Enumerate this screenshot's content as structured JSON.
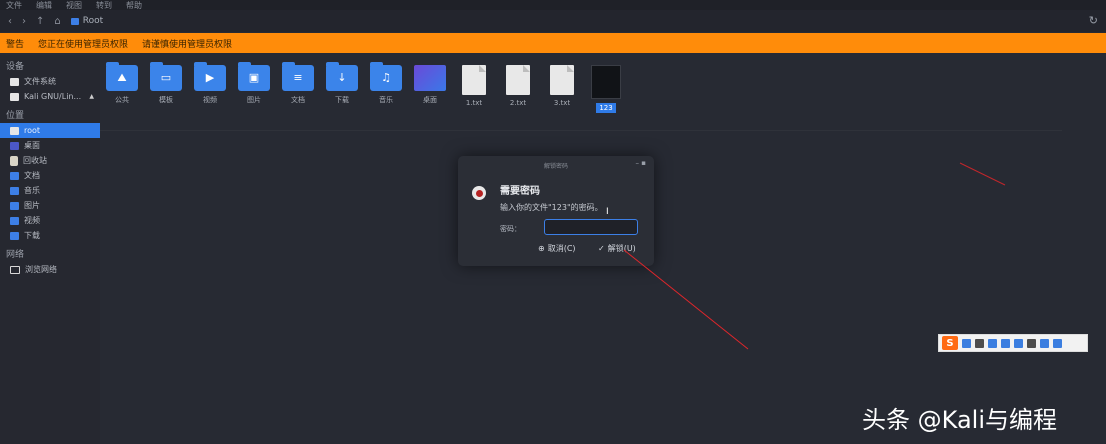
{
  "menubar": {
    "items": [
      "文件",
      "编辑",
      "视图",
      "转到",
      "帮助"
    ]
  },
  "toolbar": {
    "path": "Root",
    "back": "‹",
    "forward": "›",
    "up": "↑",
    "home": "⌂",
    "refresh": "↻"
  },
  "notice": {
    "label": "警告",
    "text1": "您正在使用管理员权限",
    "text2": "请谨慎使用管理员权限"
  },
  "sidebar": {
    "heading_devices": "设备",
    "heading_places": "位置",
    "heading_network": "网络",
    "devices": [
      {
        "label": "文件系统"
      },
      {
        "label": "Kali GNU/Lin..."
      }
    ],
    "places": [
      {
        "label": "root"
      },
      {
        "label": "桌面"
      },
      {
        "label": "回收站"
      },
      {
        "label": "文档"
      },
      {
        "label": "音乐"
      },
      {
        "label": "图片"
      },
      {
        "label": "视频"
      },
      {
        "label": "下载"
      }
    ],
    "network": [
      {
        "label": "浏览网络"
      }
    ]
  },
  "files": [
    {
      "label": "公共",
      "glyph": "⛰"
    },
    {
      "label": "模板",
      "glyph": "▭"
    },
    {
      "label": "视频",
      "glyph": "▶"
    },
    {
      "label": "图片",
      "glyph": "▣"
    },
    {
      "label": "文档",
      "glyph": "≡"
    },
    {
      "label": "下载",
      "glyph": "↓"
    },
    {
      "label": "音乐",
      "glyph": "♫"
    },
    {
      "label": "桌面"
    },
    {
      "label": "1.txt"
    },
    {
      "label": "2.txt"
    },
    {
      "label": "3.txt"
    },
    {
      "label": "123"
    }
  ],
  "dialog": {
    "title": "解锁密码",
    "heading": "需要密码",
    "message": "输入你的文件\"123\"的密码。",
    "password_label": "密码：",
    "password_value": "",
    "cancel_label": "取消(C)",
    "unlock_label": "解锁(U)",
    "winctl": "–  ▪"
  },
  "ime": {
    "logo": "S"
  },
  "watermark": "头条 @Kali与编程"
}
